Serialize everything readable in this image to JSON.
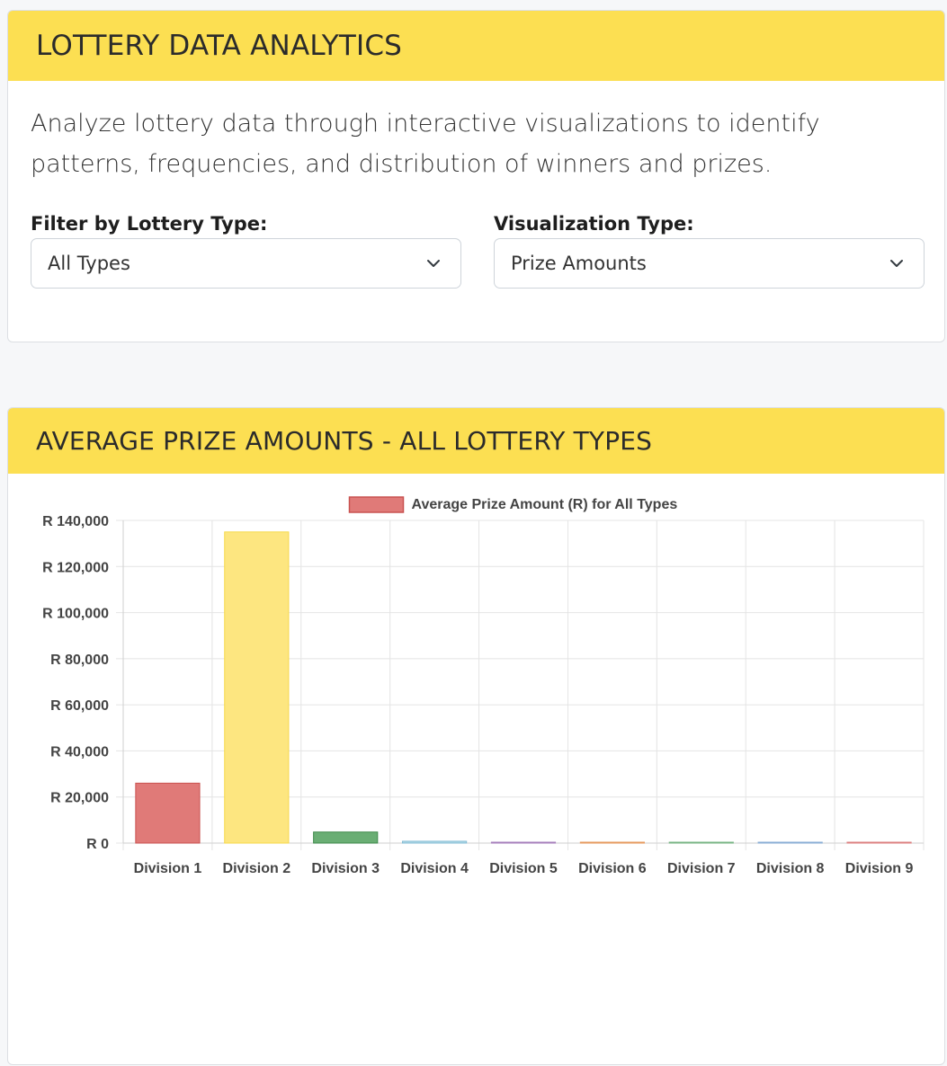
{
  "header": {
    "title": "LOTTERY DATA ANALYTICS"
  },
  "description": "Analyze lottery data through interactive visualizations to identify patterns, frequencies, and distribution of winners and prizes.",
  "filters": {
    "lottery_type": {
      "label": "Filter by Lottery Type:",
      "value": "All Types",
      "icon": "chevron-down-icon"
    },
    "visualization_type": {
      "label": "Visualization Type:",
      "value": "Prize Amounts",
      "icon": "chevron-down-icon"
    }
  },
  "chart_card": {
    "title": "AVERAGE PRIZE AMOUNTS - ALL LOTTERY TYPES"
  },
  "chart_data": {
    "type": "bar",
    "categories": [
      "Division 1",
      "Division 2",
      "Division 3",
      "Division 4",
      "Division 5",
      "Division 6",
      "Division 7",
      "Division 8",
      "Division 9"
    ],
    "series": [
      {
        "name": "Average Prize Amount (R) for All Types",
        "values": [
          26000,
          135000,
          4800,
          800,
          60,
          150,
          250,
          300,
          350
        ]
      }
    ],
    "bar_colors": [
      "#e07a78",
      "#fde680",
      "#6aae74",
      "#b4dbe8",
      "#c9a9d6",
      "#f2c29b",
      "#a8d5b0",
      "#b8cfe8",
      "#f0b0b0"
    ],
    "bar_border_colors": [
      "#c95250",
      "#f6d94a",
      "#3f8a4c",
      "#84bcd4",
      "#a67fbb",
      "#e69a5e",
      "#78b584",
      "#8aaed5",
      "#dc8080"
    ],
    "ylim": [
      0,
      140000
    ],
    "yticks": [
      0,
      20000,
      40000,
      60000,
      80000,
      100000,
      120000,
      140000
    ],
    "ytick_labels": [
      "R 0",
      "R 20,000",
      "R 40,000",
      "R 60,000",
      "R 80,000",
      "R 100,000",
      "R 120,000",
      "R 140,000"
    ],
    "grid": true,
    "legend_position": "top-center"
  }
}
